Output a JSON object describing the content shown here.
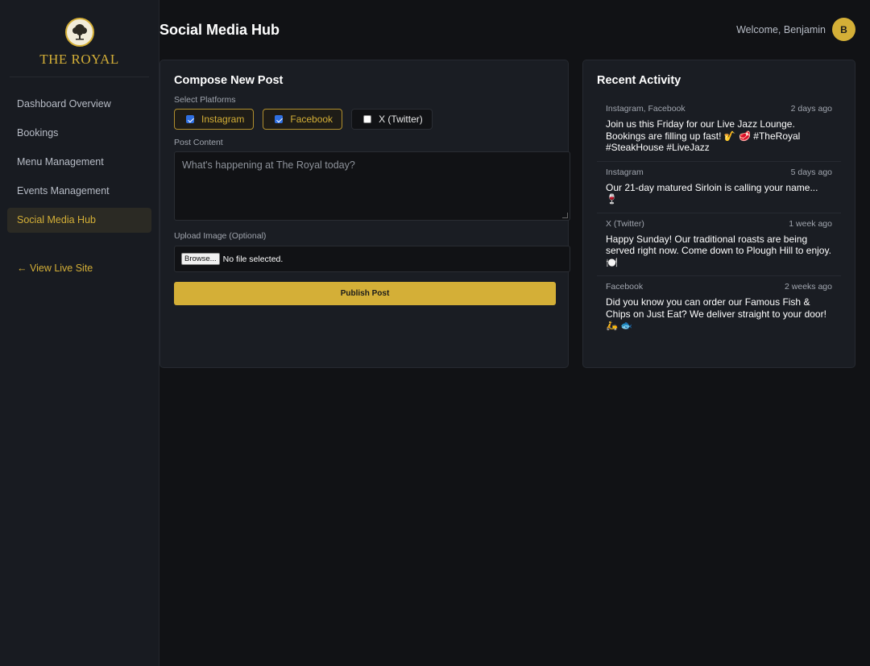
{
  "brand": {
    "name": "THE ROYAL",
    "logo_icon": "oak-tree-emblem-icon"
  },
  "sidebar": {
    "items": [
      {
        "label": "Dashboard Overview",
        "active": false
      },
      {
        "label": "Bookings",
        "active": false
      },
      {
        "label": "Menu Management",
        "active": false
      },
      {
        "label": "Events Management",
        "active": false
      },
      {
        "label": "Social Media Hub",
        "active": true
      }
    ],
    "live_link": "← View Live Site"
  },
  "header": {
    "title": "Social Media Hub",
    "welcome": "Welcome, Benjamin",
    "avatar_initial": "B"
  },
  "compose": {
    "title": "Compose New Post",
    "platforms_label": "Select Platforms",
    "platforms": [
      {
        "label": "Instagram",
        "checked": true
      },
      {
        "label": "Facebook",
        "checked": true
      },
      {
        "label": "X (Twitter)",
        "checked": false
      }
    ],
    "content_label": "Post Content",
    "content_placeholder": "What's happening at The Royal today?",
    "upload_label": "Upload Image (Optional)",
    "browse_label": "Browse...",
    "file_status": "No file selected.",
    "publish_label": "Publish Post"
  },
  "activity": {
    "title": "Recent Activity",
    "items": [
      {
        "platforms": "Instagram, Facebook",
        "time": "2 days ago",
        "text": "Join us this Friday for our Live Jazz Lounge. Bookings are filling up fast! 🎷 🥩 #TheRoyal #SteakHouse #LiveJazz"
      },
      {
        "platforms": "Instagram",
        "time": "5 days ago",
        "text": "Our 21-day matured Sirloin is calling your name... 🍷"
      },
      {
        "platforms": "X (Twitter)",
        "time": "1 week ago",
        "text": "Happy Sunday! Our traditional roasts are being served right now. Come down to Plough Hill to enjoy. 🍽️"
      },
      {
        "platforms": "Facebook",
        "time": "2 weeks ago",
        "text": "Did you know you can order our Famous Fish & Chips on Just Eat? We deliver straight to your door! 🛵 🐟"
      }
    ]
  },
  "colors": {
    "accent": "#d4af37",
    "background": "#111215",
    "sidebar": "#181b21",
    "card": "#1a1d23"
  }
}
